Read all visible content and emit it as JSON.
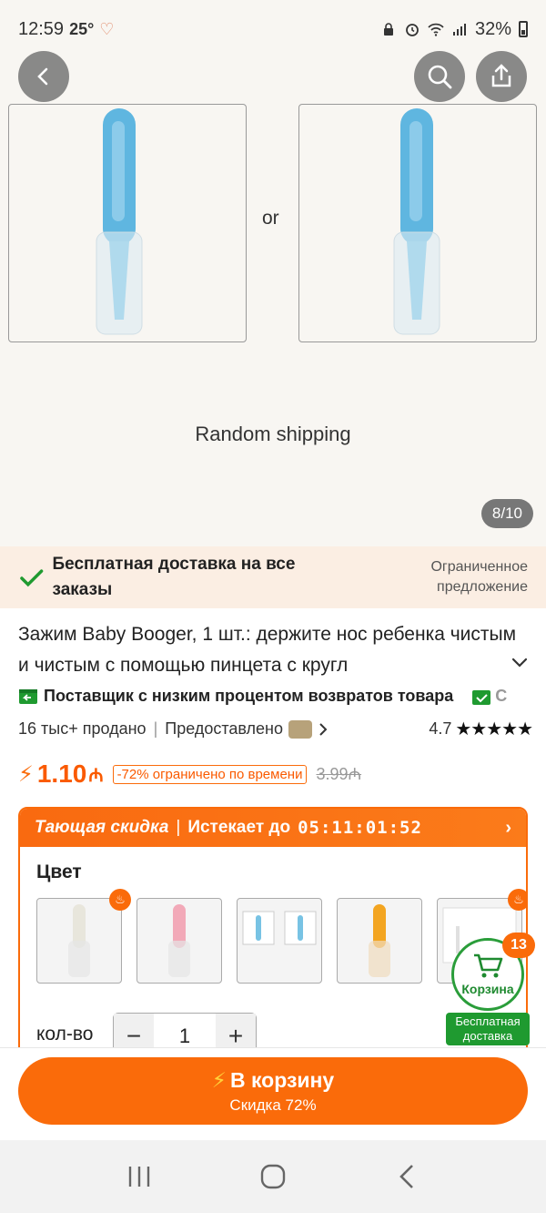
{
  "status": {
    "time": "12:59",
    "temp": "25°",
    "battery": "32%"
  },
  "gallery": {
    "or_text": "or",
    "random_shipping": "Random shipping",
    "counter": "8/10"
  },
  "free_shipping": {
    "title": "Бесплатная доставка на все заказы",
    "limited": "Ограниченное предложение"
  },
  "product": {
    "title": "Зажим Baby Booger, 1 шт.: держите нос ребенка чистым и чистым с помощью пинцета с кругл",
    "supplier": "Поставщик с низким процентом возвратов товара",
    "supplier_extra": "С",
    "sold": "16 тыс+ продано",
    "provided": "Предоставлено",
    "rating": "4.7",
    "stars": "★★★★★",
    "price": "1.10",
    "currency": "₼",
    "discount_badge": "-72% ограничено по времени",
    "old_price": "3.99₼"
  },
  "deal": {
    "name": "Тающая скидка",
    "expires": "Истекает до",
    "timer": "05:11:01:52",
    "color_label": "Цвет",
    "qty_label": "кол-во",
    "qty_value": "1",
    "minus": "−",
    "plus": "+"
  },
  "swatches": [
    {
      "color": "#e8e6dc"
    },
    {
      "color": "#f2a9b8"
    },
    {
      "color": "#78c3e4"
    },
    {
      "color": "#f3a521"
    },
    {
      "color": "#e0e0e0"
    }
  ],
  "cart_float": {
    "label": "Корзина",
    "count": "13",
    "shipping": "Бесплатная доставка"
  },
  "cta": {
    "main": "В корзину",
    "sub": "Скидка 72%"
  },
  "colors": {
    "accent": "#fa6b0a",
    "green": "#1f9a30"
  }
}
